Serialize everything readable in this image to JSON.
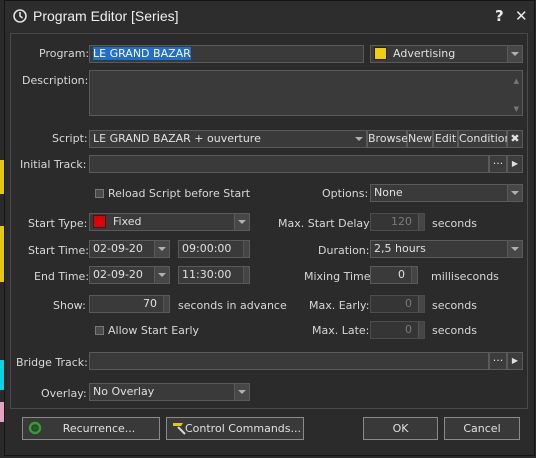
{
  "window": {
    "title": "Program Editor [Series]",
    "help_label": "?",
    "close_label": "✕"
  },
  "program": {
    "label": "Program:",
    "value": "LE GRAND BAZAR",
    "category": "Advertising",
    "category_color": "#f0d000"
  },
  "description": {
    "label": "Description:"
  },
  "script": {
    "label": "Script:",
    "value": "LE GRAND BAZAR + ouverture",
    "browse": "Browse",
    "new": "New",
    "edit": "Edit",
    "condition": "Condition",
    "clear": "✖"
  },
  "initial_track": {
    "label": "Initial Track:",
    "ellipsis": "···",
    "arrow": "▶"
  },
  "reload_script": {
    "label": "Reload Script before Start"
  },
  "options": {
    "label": "Options:",
    "value": "None"
  },
  "start_type": {
    "label": "Start Type:",
    "value": "Fixed",
    "color": "#e00000"
  },
  "max_start_delay": {
    "label": "Max. Start Delay:",
    "value": "120",
    "unit": "seconds"
  },
  "start_time": {
    "label": "Start Time:",
    "date": "02-09-20",
    "time": "09:00:00"
  },
  "duration": {
    "label": "Duration:",
    "value": "2,5 hours"
  },
  "end_time": {
    "label": "End Time:",
    "date": "02-09-20",
    "time": "11:30:00"
  },
  "mixing_time": {
    "label": "Mixing Time:",
    "value": "0",
    "unit": "milliseconds"
  },
  "show": {
    "label": "Show:",
    "value": "70",
    "unit": "seconds in advance"
  },
  "max_early": {
    "label": "Max. Early:",
    "value": "0",
    "unit": "seconds"
  },
  "allow_start_early": {
    "label": "Allow Start Early"
  },
  "max_late": {
    "label": "Max. Late:",
    "value": "0",
    "unit": "seconds"
  },
  "bridge_track": {
    "label": "Bridge Track:",
    "ellipsis": "···",
    "arrow": "▶"
  },
  "overlay": {
    "label": "Overlay:",
    "value": "No Overlay"
  },
  "footer": {
    "recurrence": "Recurrence...",
    "control_commands": "Control Commands...",
    "ok": "OK",
    "cancel": "Cancel"
  }
}
